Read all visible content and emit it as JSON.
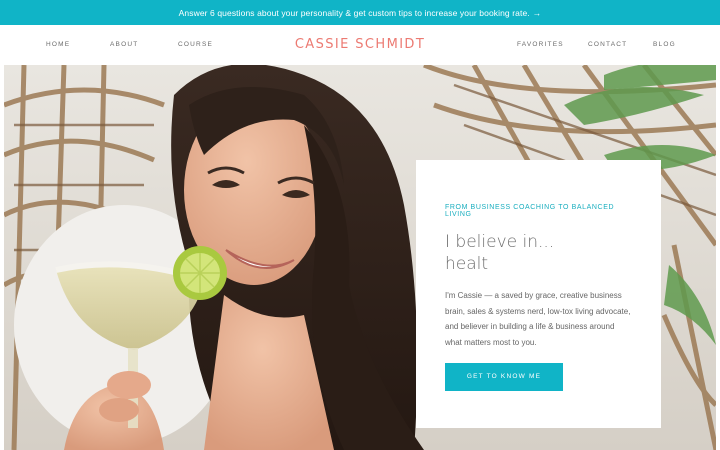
{
  "announcement": {
    "text": "Answer 6 questions about your personality & get custom tips to increase your booking rate.",
    "arrow": "→"
  },
  "nav": {
    "left_items": [
      "HOME",
      "ABOUT",
      "COURSE"
    ],
    "logo": "CASSIE SCHMIDT",
    "right_items": [
      "FAVORITES",
      "CONTACT",
      "BLOG"
    ]
  },
  "hero": {
    "image_description_icon": "woman-with-margarita-photo"
  },
  "card": {
    "eyebrow": "FROM BUSINESS COACHING TO BALANCED LIVING",
    "headline_line1": "I believe in...",
    "headline_line2": "healt",
    "body": "I'm Cassie — a saved by grace, creative business brain, sales & systems nerd, low-tox living advocate, and believer in building a life & business around what matters most to you.",
    "cta_label": "GET TO KNOW ME"
  },
  "colors": {
    "accent": "#10b4c7",
    "logo": "#ec7a72"
  }
}
